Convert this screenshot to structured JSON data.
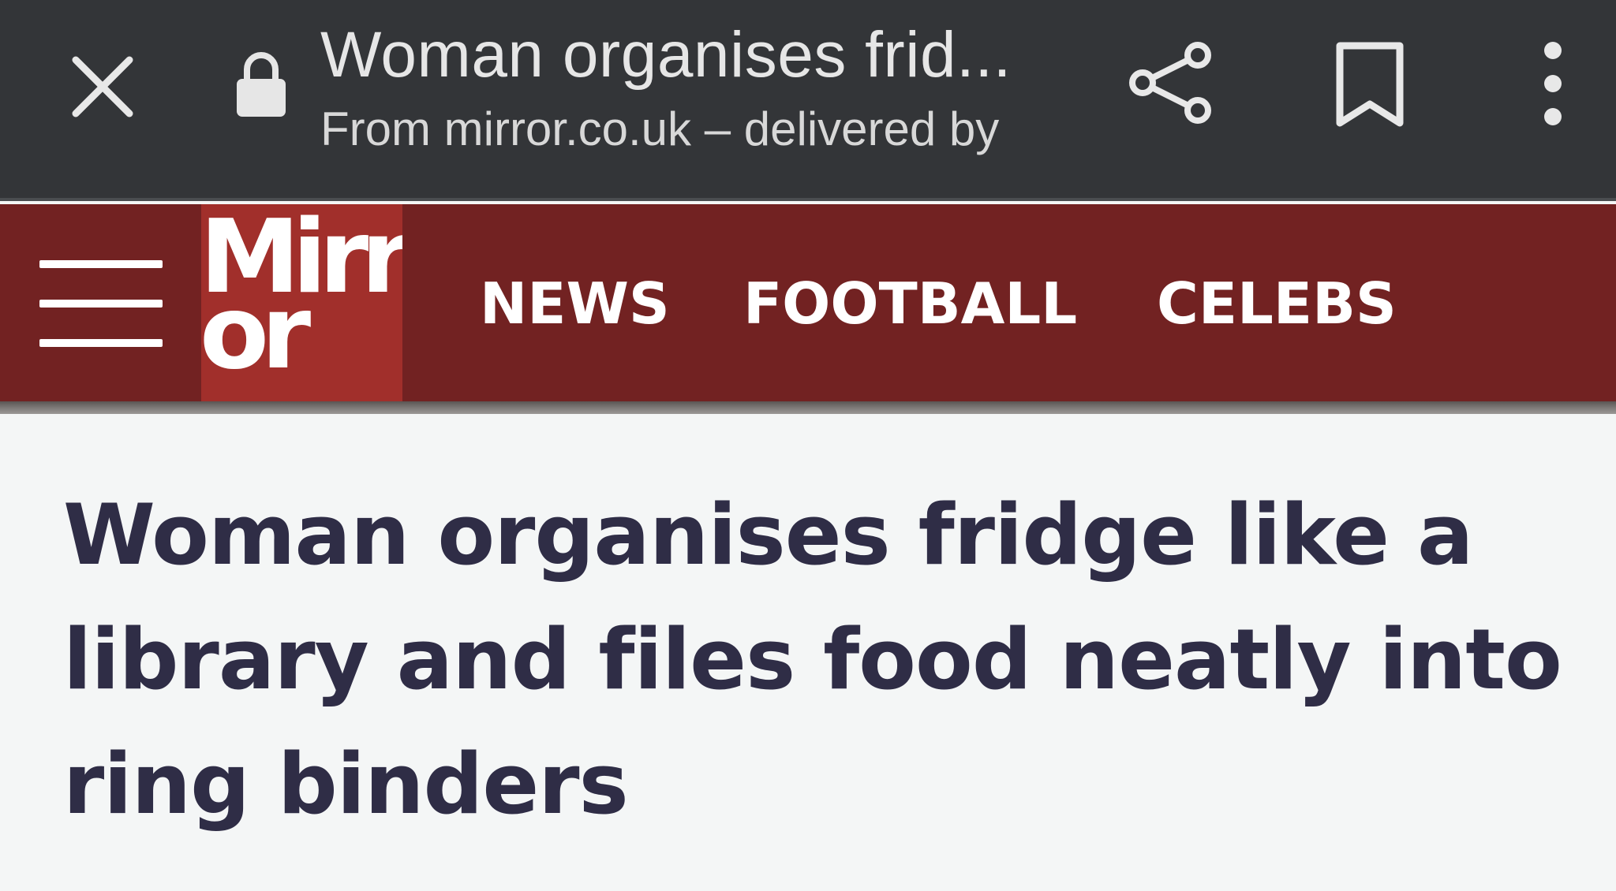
{
  "browser": {
    "title": "Woman organises frid...",
    "source": "From mirror.co.uk – delivered by"
  },
  "site": {
    "logo_line1": "Mirr",
    "logo_line2": "or",
    "nav": [
      {
        "label": "NEWS"
      },
      {
        "label": "FOOTBALL"
      },
      {
        "label": "CELEBS"
      }
    ],
    "colors": {
      "nav_bg": "#722222",
      "logo_bg": "#a12f2b",
      "browser_bar": "#333538",
      "headline": "#2f2d46"
    }
  },
  "article": {
    "headline": "Woman organises fridge like a library and files food neatly into ring binders"
  }
}
